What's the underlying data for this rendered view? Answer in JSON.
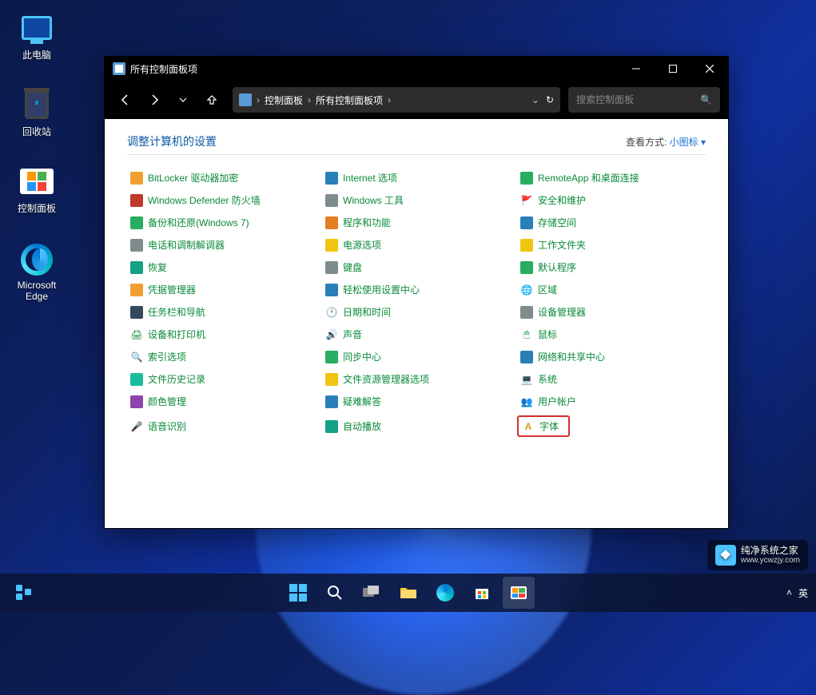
{
  "desktop": {
    "this_pc": "此电脑",
    "recycle": "回收站",
    "control_panel": "控制面板",
    "edge_l1": "Microsoft",
    "edge_l2": "Edge"
  },
  "window": {
    "title": "所有控制面板项",
    "breadcrumb": {
      "root": "控制面板",
      "current": "所有控制面板项"
    },
    "search_placeholder": "搜索控制面板",
    "heading": "调整计算机的设置",
    "view_label": "查看方式:",
    "view_value": "小图标"
  },
  "items": {
    "c0r0": "BitLocker 驱动器加密",
    "c1r0": "Internet 选项",
    "c2r0": "RemoteApp 和桌面连接",
    "c0r1": "Windows Defender 防火墙",
    "c1r1": "Windows 工具",
    "c2r1": "安全和维护",
    "c0r2": "备份和还原(Windows 7)",
    "c1r2": "程序和功能",
    "c2r2": "存储空间",
    "c0r3": "电话和调制解调器",
    "c1r3": "电源选项",
    "c2r3": "工作文件夹",
    "c0r4": "恢复",
    "c1r4": "键盘",
    "c2r4": "默认程序",
    "c0r5": "凭据管理器",
    "c1r5": "轻松使用设置中心",
    "c2r5": "区域",
    "c0r6": "任务栏和导航",
    "c1r6": "日期和时间",
    "c2r6": "设备管理器",
    "c0r7": "设备和打印机",
    "c1r7": "声音",
    "c2r7": "鼠标",
    "c0r8": "索引选项",
    "c1r8": "同步中心",
    "c2r8": "网络和共享中心",
    "c0r9": "文件历史记录",
    "c1r9": "文件资源管理器选项",
    "c2r9": "系统",
    "c0r10": "颜色管理",
    "c1r10": "疑难解答",
    "c2r10": "用户帐户",
    "c0r11": "语音识别",
    "c1r11": "自动播放",
    "c2r11": "字体"
  },
  "taskbar": {
    "lang": "英"
  },
  "watermark": {
    "line1": "纯净系统之家",
    "line2": "www.ycwzjy.com"
  }
}
